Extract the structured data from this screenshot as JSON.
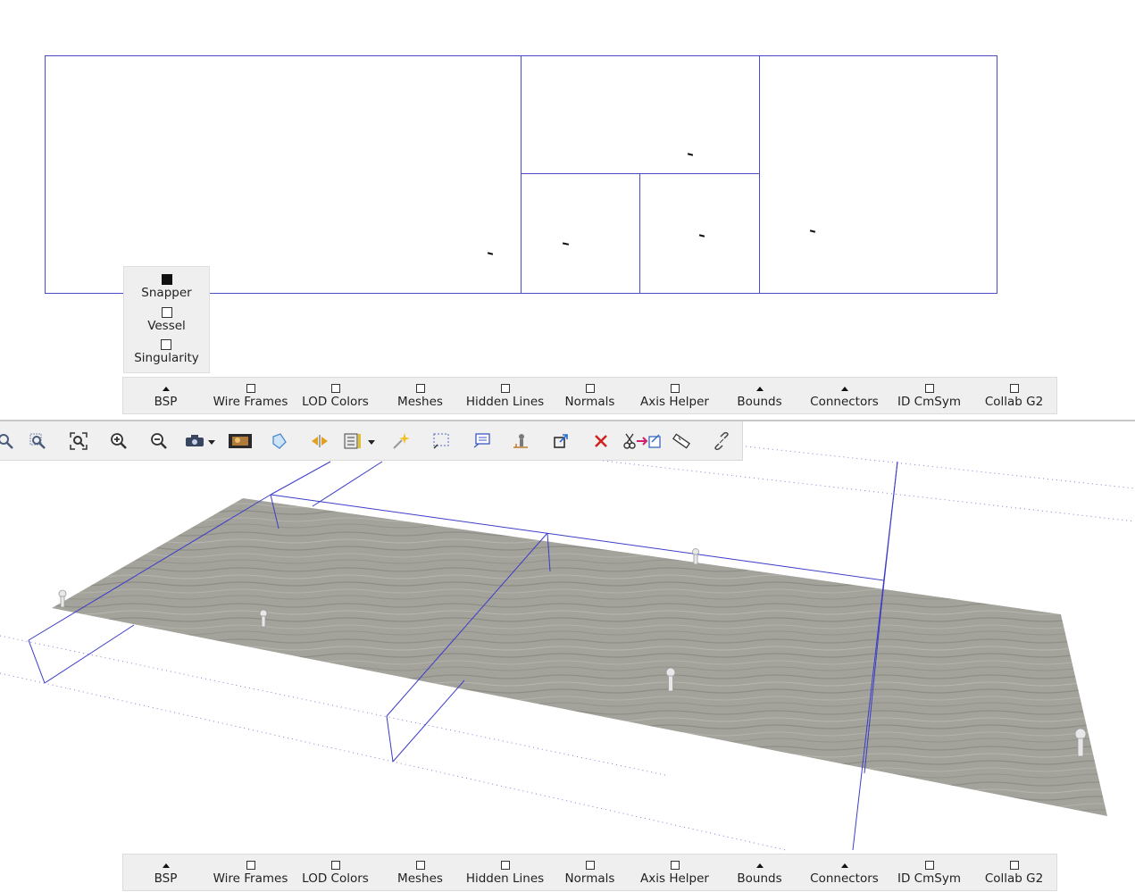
{
  "layer_panel": {
    "items": [
      {
        "label": "Snapper",
        "checked": true
      },
      {
        "label": "Vessel",
        "checked": false
      },
      {
        "label": "Singularity",
        "checked": false
      }
    ]
  },
  "overlay_toolbar": {
    "items": [
      {
        "label": "BSP",
        "state": "expanded"
      },
      {
        "label": "Wire Frames",
        "state": "unchecked"
      },
      {
        "label": "LOD Colors",
        "state": "unchecked"
      },
      {
        "label": "Meshes",
        "state": "unchecked"
      },
      {
        "label": "Hidden Lines",
        "state": "unchecked"
      },
      {
        "label": "Normals",
        "state": "unchecked"
      },
      {
        "label": "Axis Helper",
        "state": "unchecked"
      },
      {
        "label": "Bounds",
        "state": "expanded"
      },
      {
        "label": "Connectors",
        "state": "expanded"
      },
      {
        "label": "ID CmSym",
        "state": "unchecked"
      },
      {
        "label": "Collab G2",
        "state": "unchecked"
      }
    ]
  },
  "viewport_toolbar": {
    "icons": [
      "zoom-icon",
      "zoom-region-icon",
      "zoom-extents-icon",
      "zoom-in-icon",
      "zoom-out-icon",
      "camera-dropdown-icon",
      "film-icon",
      "tag-icon",
      "flip-horizontal-icon",
      "layout-dropdown-icon",
      "sparkle-select-icon",
      "marquee-select-icon",
      "comment-icon",
      "user-pin-icon",
      "transform-icon",
      "delete-icon",
      "cut-paste-icon",
      "measure-icon",
      "unlink-icon"
    ]
  },
  "colors": {
    "wire": "#3c3cc8",
    "floor": "#a3a39b",
    "panel_bg": "#efefef"
  }
}
